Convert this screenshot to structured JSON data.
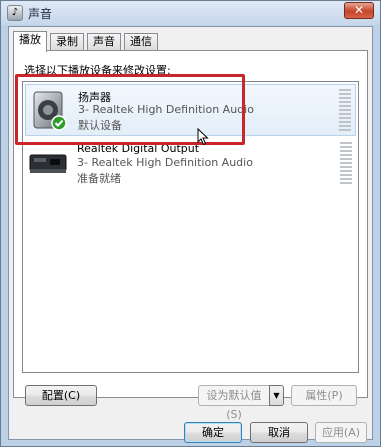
{
  "window": {
    "title": "声音",
    "close_label": "✕"
  },
  "tabs": [
    {
      "label": "播放",
      "active": true
    },
    {
      "label": "录制",
      "active": false
    },
    {
      "label": "声音",
      "active": false
    },
    {
      "label": "通信",
      "active": false
    }
  ],
  "instruction": "选择以下播放设备来修改设置:",
  "devices": [
    {
      "name": "扬声器",
      "subtitle": "3- Realtek High Definition Audio",
      "status": "默认设备",
      "icon": "speaker-icon",
      "selected": true,
      "default_badge": "check-icon"
    },
    {
      "name": "Realtek Digital Output",
      "subtitle": "3- Realtek High Definition Audio",
      "status": "准备就绪",
      "icon": "digital-output-icon",
      "selected": false
    }
  ],
  "buttons": {
    "configure": "配置(C)",
    "set_default": "设为默认值(S)",
    "properties": "属性(P)",
    "ok": "确定",
    "cancel": "取消",
    "apply": "应用(A)"
  },
  "colors": {
    "highlight": "#c8262b",
    "selection": "#e3eef9",
    "check": "#2e9c2a"
  }
}
